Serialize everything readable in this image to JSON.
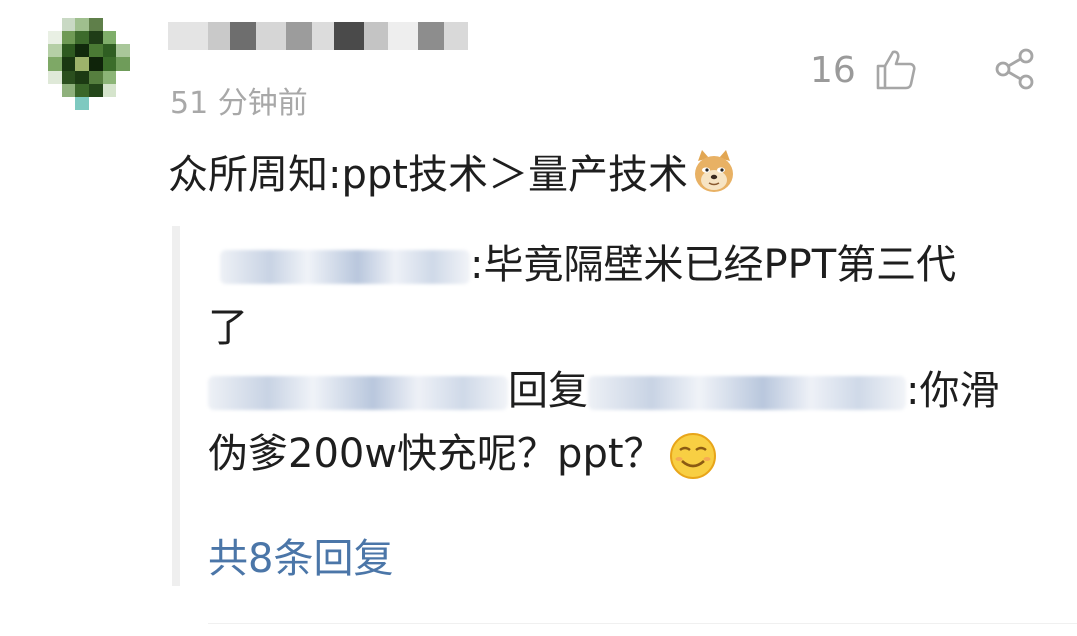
{
  "comment": {
    "timestamp": "51 分钟前",
    "likes": "16",
    "text": "众所周知:ppt技术＞量产技术",
    "emoji": "doge-emoji"
  },
  "replies": [
    {
      "text_line1": ":毕竟隔壁米已经PPT第三代",
      "text_line2": "了"
    },
    {
      "reply_word": "回复",
      "text_line1": ":你滑",
      "text_line2": "伪爹200w快充呢？ppt？",
      "emoji": "smirk-emoji"
    }
  ],
  "more_replies": "共8条回复",
  "colors": {
    "link": "#4b76a8",
    "muted": "#a8a8a8",
    "text": "#1e1e1e"
  },
  "icons": [
    "thumbs-up-icon",
    "share-icon"
  ]
}
